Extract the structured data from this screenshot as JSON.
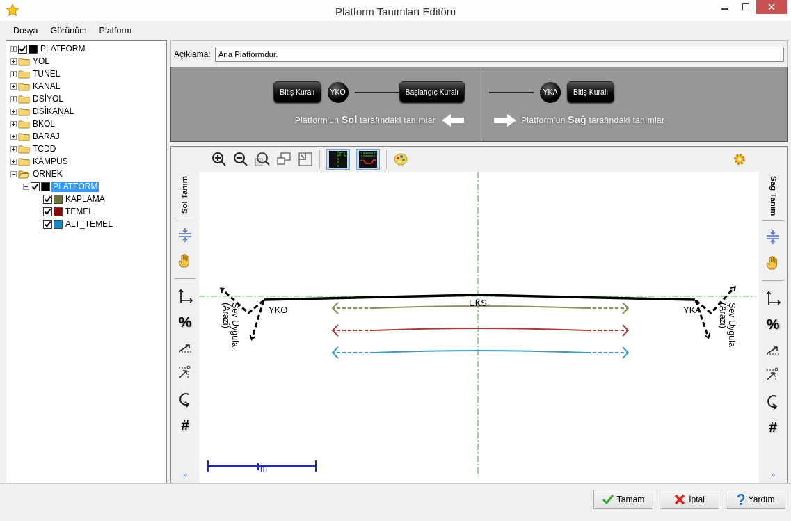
{
  "window": {
    "title": "Platform Tanımları Editörü"
  },
  "menu": [
    "Dosya",
    "Görünüm",
    "Platform"
  ],
  "tree": [
    {
      "label": "PLATFORM",
      "kind": "layer",
      "checked": true,
      "color": "#000000",
      "expanded": false,
      "selected": false
    },
    {
      "label": "YOL",
      "kind": "folder",
      "expanded": false,
      "selected": false
    },
    {
      "label": "TUNEL",
      "kind": "folder",
      "expanded": false,
      "selected": false
    },
    {
      "label": "KANAL",
      "kind": "folder",
      "expanded": false,
      "selected": false
    },
    {
      "label": "DSİYOL",
      "kind": "folder",
      "expanded": false,
      "selected": false
    },
    {
      "label": "DSİKANAL",
      "kind": "folder",
      "expanded": false,
      "selected": false
    },
    {
      "label": "BKOL",
      "kind": "folder",
      "expanded": false,
      "selected": false
    },
    {
      "label": "BARAJ",
      "kind": "folder",
      "expanded": false,
      "selected": false
    },
    {
      "label": "TCDD",
      "kind": "folder",
      "expanded": false,
      "selected": false
    },
    {
      "label": "KAMPUS",
      "kind": "folder",
      "expanded": false,
      "selected": false
    },
    {
      "label": "ORNEK",
      "kind": "folder",
      "expanded": true,
      "selected": false,
      "children": [
        {
          "label": "PLATFORM",
          "kind": "layer",
          "checked": true,
          "color": "#000000",
          "expanded": true,
          "selected": true,
          "children": [
            {
              "label": "KAPLAMA",
              "kind": "layer",
              "checked": true,
              "color": "#6e6e3c"
            },
            {
              "label": "TEMEL",
              "kind": "layer",
              "checked": true,
              "color": "#8b0a0a"
            },
            {
              "label": "ALT_TEMEL",
              "kind": "layer",
              "checked": true,
              "color": "#1a86c8"
            }
          ]
        }
      ]
    }
  ],
  "description": {
    "label": "Açıklama:",
    "value": "Ana Platformdur."
  },
  "rules": {
    "left": {
      "end_rule": "Bitiş Kuralı",
      "node": "YKO",
      "start_rule": "Başlangıç Kuralı",
      "caption": "Platform'un **Sol** tarafındaki tanımlar"
    },
    "right": {
      "node": "YKA",
      "end_rule": "Bitiş Kuralı",
      "caption": "Platform'un **Sağ** tarafındaki tanımlar"
    }
  },
  "toolbar": [
    {
      "kind": "zoom-in"
    },
    {
      "kind": "zoom-out"
    },
    {
      "kind": "zoom-extent"
    },
    {
      "kind": "window"
    },
    {
      "kind": "fit"
    },
    {
      "kind": "centerline",
      "on": true
    },
    {
      "kind": "labels",
      "on": true
    },
    {
      "kind": "palette"
    }
  ],
  "left_panel": {
    "title": "Sol Tanım",
    "tools": [
      {
        "kind": "compress"
      },
      {
        "kind": "pan"
      },
      {
        "kind": "axes",
        "separator_before": true
      },
      {
        "kind": "text",
        "text": "%"
      },
      {
        "kind": "slope"
      },
      {
        "kind": "pick"
      },
      {
        "kind": "rotate"
      },
      {
        "kind": "text",
        "text": "#"
      },
      {
        "kind": "more",
        "text": "»"
      }
    ]
  },
  "right_panel": {
    "title": "Sağ Tanım",
    "tools": [
      {
        "kind": "compress"
      },
      {
        "kind": "pan"
      },
      {
        "kind": "axes",
        "separator_before": true
      },
      {
        "kind": "text",
        "text": "%"
      },
      {
        "kind": "slope"
      },
      {
        "kind": "pick"
      },
      {
        "kind": "rotate"
      },
      {
        "kind": "text",
        "text": "#"
      },
      {
        "kind": "more",
        "text": "»"
      }
    ]
  },
  "canvas": {
    "centre_label": "EKS",
    "left_edge_label": "YKO",
    "right_edge_label": "YKA",
    "left_slope_label": [
      "Şev Uygula",
      "(Arazi)"
    ],
    "right_slope_label": [
      "Şev Uygula",
      "(Arazi)"
    ],
    "layers": [
      {
        "color": "#8c8c5c"
      },
      {
        "color": "#a83a3a"
      },
      {
        "color": "#3a9ac8"
      }
    ],
    "scale_label": "m"
  },
  "buttons": [
    {
      "label": "Tamam",
      "kind": "ok"
    },
    {
      "label": "İptal",
      "kind": "cancel"
    },
    {
      "label": "Yardım",
      "kind": "help"
    }
  ]
}
